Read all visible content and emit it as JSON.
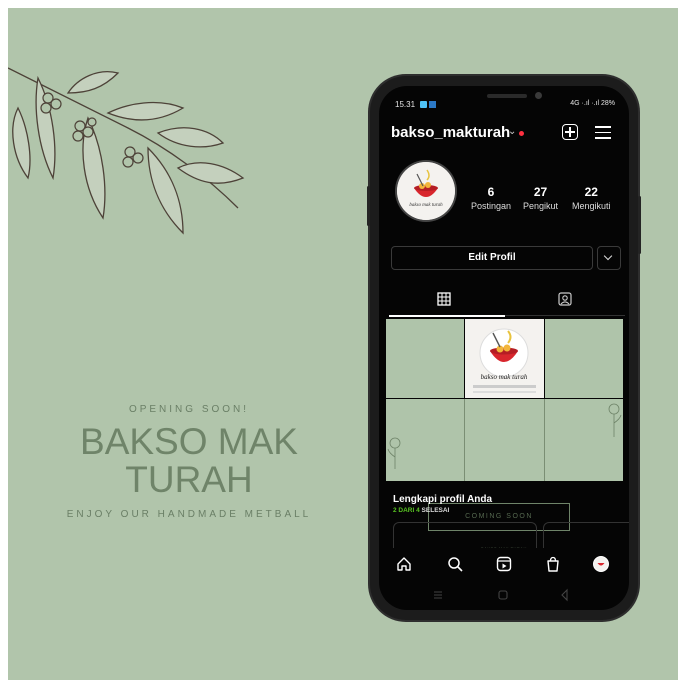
{
  "poster": {
    "opening": "OPENING SOON!",
    "title_line1": "BAKSO MAK",
    "title_line2": "TURAH",
    "tagline": "ENJOY OUR HANDMADE METBALL"
  },
  "status_bar": {
    "time": "15.31",
    "right": "4G ·.ıl ·.ıl 28%"
  },
  "profile": {
    "username": "bakso_makturah",
    "stats": [
      {
        "count": "6",
        "label": "Postingan"
      },
      {
        "count": "27",
        "label": "Pengikut"
      },
      {
        "count": "22",
        "label": "Mengikuti"
      }
    ],
    "edit_button": "Edit Profil",
    "avatar_text": "bakso mak turah"
  },
  "grid_posts": {
    "coming_soon": "COMING SOON",
    "small_text": "BAKSO MAK TURAH",
    "logo_text": "bakso mak turah"
  },
  "complete_profile": {
    "title": "Lengkapi profil Anda",
    "progress_done": "2 DARI 4",
    "progress_rest": "SELESAI"
  },
  "icons": [
    "add-icon",
    "menu-icon",
    "chevron-down-icon",
    "grid-icon",
    "tagged-icon",
    "home-icon",
    "search-icon",
    "reels-icon",
    "shop-icon",
    "profile-avatar-icon"
  ],
  "colors": {
    "accent_green": "#58c322",
    "notification_red": "#ff3040",
    "poster_bg": "#b1c5ab"
  }
}
